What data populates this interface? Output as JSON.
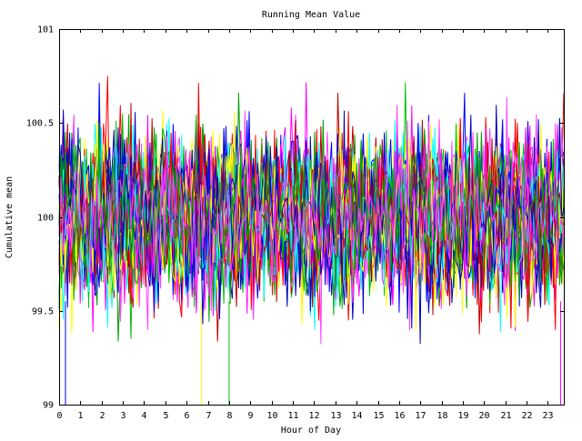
{
  "chart_data": {
    "type": "line",
    "title": "Running Mean Value",
    "xlabel": "Hour of Day",
    "ylabel": "Cumulative mean",
    "xlim": [
      0,
      23.75
    ],
    "ylim": [
      99,
      101
    ],
    "x_ticks": [
      0,
      1,
      2,
      3,
      4,
      5,
      6,
      7,
      8,
      9,
      10,
      11,
      12,
      13,
      14,
      15,
      16,
      17,
      18,
      19,
      20,
      21,
      22,
      23
    ],
    "x_tick_labels": [
      "0",
      "1",
      "2",
      "3",
      "4",
      "5",
      "6",
      "7",
      "8",
      "9",
      "10",
      "11",
      "12",
      "13",
      "14",
      "15",
      "16",
      "17",
      "18",
      "19",
      "20",
      "21",
      "22",
      "23"
    ],
    "y_ticks": [
      99,
      99.5,
      100,
      100.5,
      101
    ],
    "y_tick_labels": [
      "99",
      "99.5",
      "100",
      "100.5",
      "101"
    ],
    "grid": false,
    "legend": "none",
    "series_count": 40,
    "samples_per_series": 240,
    "series_center": 100,
    "typical_band": [
      99.6,
      100.4
    ],
    "observed_max": 100.75,
    "observed_min": 99,
    "series_colors": [
      "#ff0000",
      "#00c000",
      "#0000ff",
      "#ff00ff",
      "#00ffff",
      "#ffff00",
      "#c00000",
      "#0000c0",
      "#00a000",
      "#ff40ff"
    ]
  }
}
